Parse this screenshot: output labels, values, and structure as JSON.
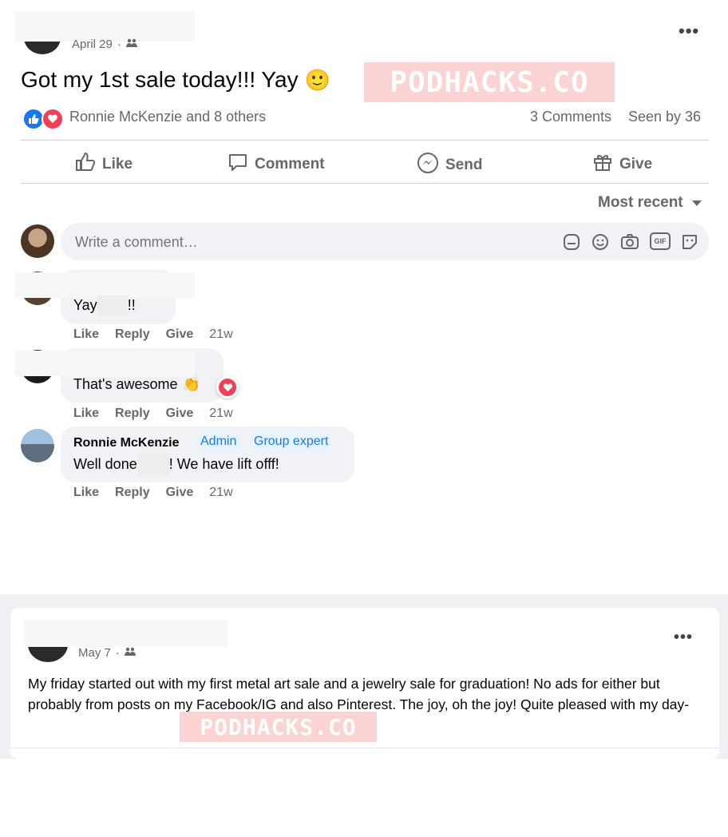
{
  "post1": {
    "date": "April 29",
    "separator": "·",
    "title": "Got my 1st sale today!!! Yay",
    "title_emoji": "🙂",
    "watermark": "PODHACKS.CO",
    "reactions_text": "Ronnie McKenzie and 8 others",
    "comments_count": "3 Comments",
    "seen_by": "Seen by 36",
    "actions": {
      "like": "Like",
      "comment": "Comment",
      "send": "Send",
      "give": "Give"
    },
    "sort_label": "Most recent",
    "comment_placeholder": "Write a comment…",
    "composer_icons": [
      "sticker-icon",
      "emoji-icon",
      "camera-icon",
      "gif-icon",
      "avatar-sticker-icon"
    ],
    "gif_label": "GIF",
    "comments": [
      {
        "text_a": "Yay ",
        "text_b": "!!",
        "links": [
          "Like",
          "Reply",
          "Give"
        ],
        "time": "21w"
      },
      {
        "text": "That's awesome",
        "emoji": "👏",
        "links": [
          "Like",
          "Reply",
          "Give"
        ],
        "time": "21w"
      },
      {
        "author": "Ronnie McKenzie",
        "badges": [
          "Admin",
          "Group expert"
        ],
        "text_a": "Well done ",
        "text_b": "! We have lift offf!",
        "links": [
          "Like",
          "Reply",
          "Give"
        ],
        "time": "21w"
      }
    ]
  },
  "post2": {
    "date": "May 7",
    "separator": "·",
    "body": "My friday started out with my first metal art sale and a jewelry sale for graduation! No ads for either but probably from posts on my Facebook/IG and also Pinterest. The joy, oh the joy! Quite pleased with my day-",
    "watermark": "PODHACKS.CO"
  },
  "colors": {
    "like_blue": "#1877f2",
    "love_red": "#f33e58",
    "watermark_pink": "#fbd3d3",
    "meta_gray": "#65676b",
    "bubble_bg": "#f0f2f5"
  }
}
